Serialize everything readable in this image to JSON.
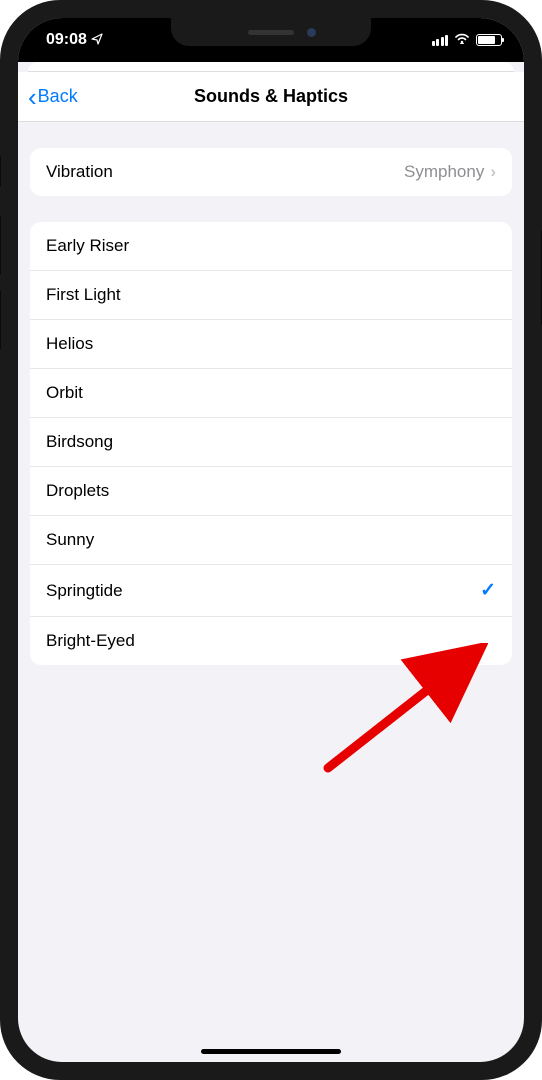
{
  "status_bar": {
    "time": "09:08"
  },
  "nav": {
    "back_label": "Back",
    "title": "Sounds & Haptics"
  },
  "vibration": {
    "label": "Vibration",
    "value": "Symphony"
  },
  "sounds": [
    {
      "label": "Early Riser",
      "selected": false
    },
    {
      "label": "First Light",
      "selected": false
    },
    {
      "label": "Helios",
      "selected": false
    },
    {
      "label": "Orbit",
      "selected": false
    },
    {
      "label": "Birdsong",
      "selected": false
    },
    {
      "label": "Droplets",
      "selected": false
    },
    {
      "label": "Sunny",
      "selected": false
    },
    {
      "label": "Springtide",
      "selected": true
    },
    {
      "label": "Bright-Eyed",
      "selected": false
    }
  ]
}
